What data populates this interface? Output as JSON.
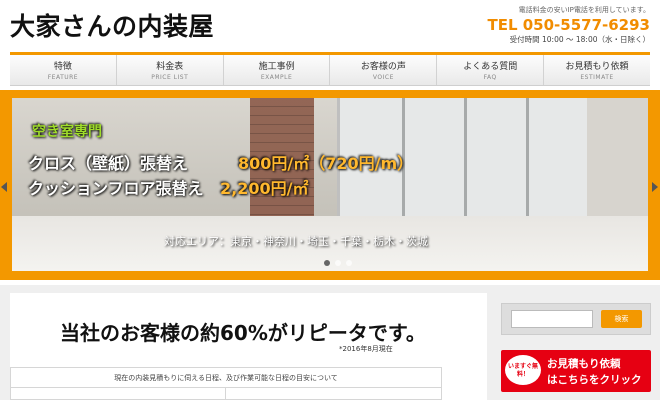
{
  "header": {
    "logo": "大家さんの内装屋",
    "note": "電話料金の安いIP電話を利用しています。",
    "tel": "TEL 050-5577-6293",
    "hours": "受付時間 10:00 ～ 18:00（水・日除く）"
  },
  "nav": [
    {
      "jp": "特徴",
      "en": "FEATURE"
    },
    {
      "jp": "料金表",
      "en": "PRICE LIST"
    },
    {
      "jp": "施工事例",
      "en": "EXAMPLE"
    },
    {
      "jp": "お客様の声",
      "en": "VOICE"
    },
    {
      "jp": "よくある質問",
      "en": "FAQ"
    },
    {
      "jp": "お見積もり依頼",
      "en": "ESTIMATE"
    }
  ],
  "slide": {
    "vacant": "空き室専門",
    "cloth": "クロス（壁紙）張替え",
    "cloth_price": "800円/㎡（720円/m）",
    "cushion": "クッションフロア張替え",
    "cushion_price": "2,200円/㎡",
    "area": "対応エリア：東京・神奈川・埼玉・千葉・栃木・茨城"
  },
  "main": {
    "headline": "当社のお客様の約60%がリピータです。",
    "footnote": "*2016年8月現在",
    "table_head": "現在の内装見積もりに伺える日程、及び作業可能な日程の目安について"
  },
  "sidebar": {
    "search_button": "検索",
    "badge": "いますぐ無料！",
    "estimate_line1": "お見積もり依頼",
    "estimate_line2": "はこちらをクリック"
  },
  "colors": {
    "accent": "#f39800",
    "estimate_red": "#e60012"
  }
}
